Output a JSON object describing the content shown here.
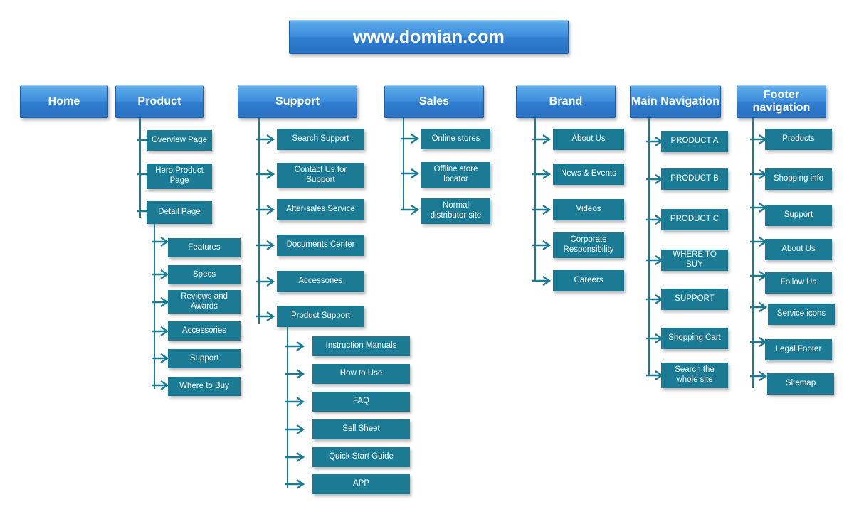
{
  "diagram": {
    "title_box": {
      "label": "www.domian.com"
    },
    "columns": [
      {
        "id": "home",
        "label": "Home",
        "children": []
      },
      {
        "id": "product",
        "label": "Product",
        "children": [
          {
            "label": "Overview Page"
          },
          {
            "label": "Hero Product Page"
          },
          {
            "label": "Detail Page",
            "children": [
              {
                "label": "Features"
              },
              {
                "label": "Specs"
              },
              {
                "label": "Reviews and Awards"
              },
              {
                "label": "Accessories"
              },
              {
                "label": "Support"
              },
              {
                "label": "Where to Buy"
              }
            ]
          }
        ]
      },
      {
        "id": "support",
        "label": "Support",
        "children": [
          {
            "label": "Search Support"
          },
          {
            "label": "Contact Us for Support"
          },
          {
            "label": "After-sales Service"
          },
          {
            "label": "Documents Center"
          },
          {
            "label": "Accessories"
          },
          {
            "label": "Product Support",
            "children": [
              {
                "label": "Instruction Manuals"
              },
              {
                "label": "How to Use"
              },
              {
                "label": "FAQ"
              },
              {
                "label": "Sell Sheet"
              },
              {
                "label": "Quick Start Guide"
              },
              {
                "label": "APP"
              }
            ]
          }
        ]
      },
      {
        "id": "sales",
        "label": "Sales",
        "children": [
          {
            "label": "Online stores"
          },
          {
            "label": "Offline store locator"
          },
          {
            "label": "Normal distributor site"
          }
        ]
      },
      {
        "id": "brand",
        "label": "Brand",
        "children": [
          {
            "label": "About Us"
          },
          {
            "label": "News & Events"
          },
          {
            "label": "Videos"
          },
          {
            "label": "Corporate Responsibility"
          },
          {
            "label": "Careers"
          }
        ]
      },
      {
        "id": "main-navigation",
        "label": "Main Navigation",
        "children": [
          {
            "label": "PRODUCT A"
          },
          {
            "label": "PRODUCT B"
          },
          {
            "label": "PRODUCT C"
          },
          {
            "label": "WHERE TO BUY"
          },
          {
            "label": "SUPPORT"
          },
          {
            "label": "Shopping Cart"
          },
          {
            "label": "Search the whole site"
          }
        ]
      },
      {
        "id": "footer-navigation",
        "label": "Footer navigation",
        "children": [
          {
            "label": "Products"
          },
          {
            "label": "Shopping info"
          },
          {
            "label": "Support"
          },
          {
            "label": "About Us"
          },
          {
            "label": "Follow Us"
          },
          {
            "label": "Service icons"
          },
          {
            "label": "Legal Footer"
          },
          {
            "label": "Sitemap"
          }
        ]
      }
    ],
    "colors": {
      "node_fill": "#1b7b94",
      "connector": "#1b7b94",
      "header_blue": "#2f7ed0",
      "header_border": "#1f5fa8",
      "background": "#ffffff",
      "text": "#ffffff"
    }
  }
}
